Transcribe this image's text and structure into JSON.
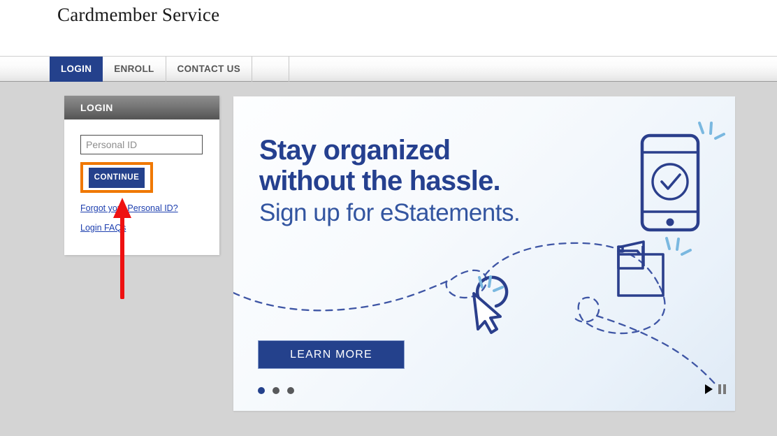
{
  "header": {
    "brand_title": "Cardmember Service"
  },
  "nav": {
    "tabs": [
      {
        "label": "LOGIN",
        "active": true
      },
      {
        "label": "ENROLL",
        "active": false
      },
      {
        "label": "CONTACT US",
        "active": false
      }
    ]
  },
  "login_panel": {
    "title": "LOGIN",
    "personal_id_placeholder": "Personal ID",
    "personal_id_value": "",
    "continue_label": "CONTINUE",
    "forgot_link_label": "Forgot your Personal ID?",
    "faq_link_label": "Login FAQs",
    "highlight_color": "#f07800",
    "button_color": "#24418c"
  },
  "hero": {
    "headline_line1": "Stay organized",
    "headline_line2": "without the hassle.",
    "subline": "Sign up for eStatements.",
    "cta_label": "LEARN MORE",
    "accent_color": "#25408f",
    "sparkle_color": "#7ab8e0",
    "carousel": {
      "slide_count": 3,
      "active_slide": 1,
      "play_label": "play",
      "pause_label": "pause"
    },
    "illustration": {
      "phone_icon": "mobile-phone-with-checkmark",
      "cursor_icon": "mouse-cursor-click",
      "folder_icon": "folder-with-document",
      "path_icon": "dashed-connector-path"
    }
  },
  "annotation": {
    "arrow_color": "#ee1111",
    "arrow_direction": "up",
    "points_to": "continue-button"
  }
}
